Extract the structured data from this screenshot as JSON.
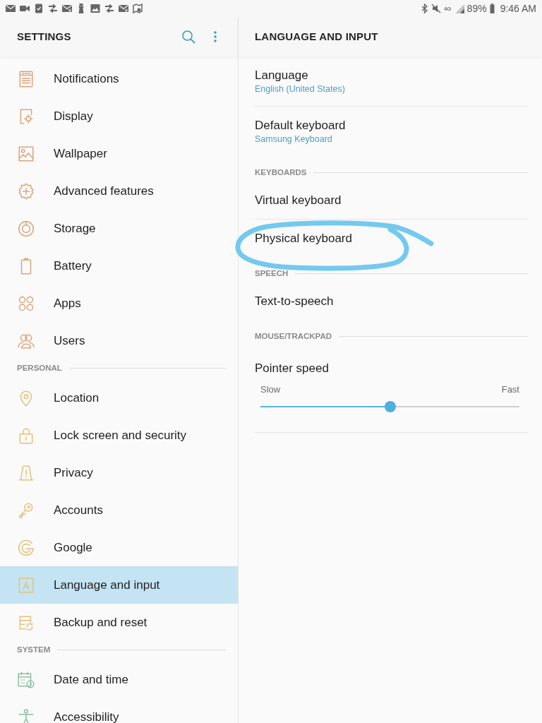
{
  "status_bar": {
    "network": "4G",
    "battery": "89%",
    "time": "9:46 AM"
  },
  "sidebar": {
    "title": "SETTINGS",
    "sections": [
      {
        "items": [
          {
            "label": "Notifications",
            "color": "#dfa47a",
            "selected": false
          },
          {
            "label": "Display",
            "color": "#dfa47a",
            "selected": false
          },
          {
            "label": "Wallpaper",
            "color": "#dfa47a",
            "selected": false
          },
          {
            "label": "Advanced features",
            "color": "#dfa47a",
            "selected": false
          },
          {
            "label": "Storage",
            "color": "#dfa47a",
            "selected": false
          },
          {
            "label": "Battery",
            "color": "#dfa47a",
            "selected": false
          },
          {
            "label": "Apps",
            "color": "#dfa47a",
            "selected": false
          },
          {
            "label": "Users",
            "color": "#dfa47a",
            "selected": false
          }
        ]
      },
      {
        "header": "PERSONAL",
        "items": [
          {
            "label": "Location",
            "color": "#e4c27c",
            "selected": false
          },
          {
            "label": "Lock screen and security",
            "color": "#e4c27c",
            "selected": false
          },
          {
            "label": "Privacy",
            "color": "#e4c27c",
            "selected": false
          },
          {
            "label": "Accounts",
            "color": "#e4c27c",
            "selected": false
          },
          {
            "label": "Google",
            "color": "#e4c27c",
            "selected": false
          },
          {
            "label": "Language and input",
            "color": "#e4c27c",
            "selected": true
          },
          {
            "label": "Backup and reset",
            "color": "#e4c27c",
            "selected": false
          }
        ]
      },
      {
        "header": "SYSTEM",
        "items": [
          {
            "label": "Date and time",
            "color": "#8dc29c",
            "selected": false
          },
          {
            "label": "Accessibility",
            "color": "#8dc29c",
            "selected": false
          }
        ]
      }
    ]
  },
  "detail": {
    "title": "LANGUAGE AND INPUT",
    "sections": [
      {
        "items": [
          {
            "kind": "link",
            "title": "Language",
            "summary": "English (United States)",
            "circled": false
          },
          {
            "kind": "link",
            "title": "Default keyboard",
            "summary": "Samsung Keyboard",
            "circled": false
          }
        ]
      },
      {
        "header": "KEYBOARDS",
        "items": [
          {
            "kind": "link",
            "title": "Virtual keyboard",
            "circled": false
          },
          {
            "kind": "link",
            "title": "Physical keyboard",
            "circled": true
          }
        ]
      },
      {
        "header": "SPEECH",
        "items": [
          {
            "kind": "link",
            "title": "Text-to-speech",
            "circled": false
          }
        ]
      },
      {
        "header": "MOUSE/TRACKPAD",
        "items": [
          {
            "kind": "slider",
            "title": "Pointer speed",
            "min_label": "Slow",
            "max_label": "Fast",
            "level": 0.5,
            "circled": false
          }
        ]
      }
    ]
  }
}
